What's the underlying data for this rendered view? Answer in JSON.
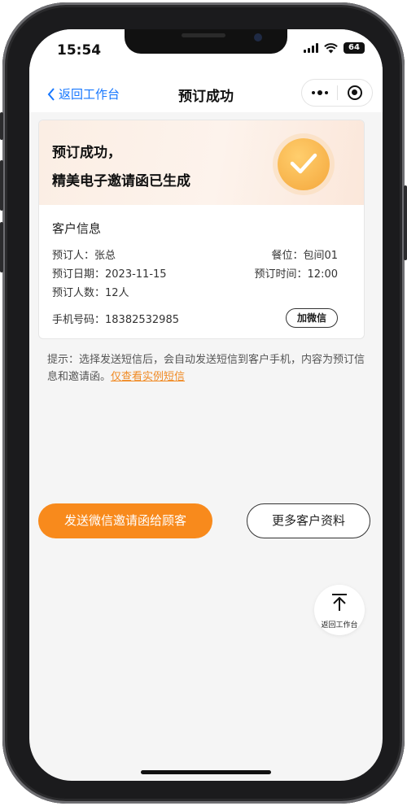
{
  "status_bar": {
    "time": "15:54",
    "battery": "64"
  },
  "nav": {
    "back_label": "返回工作台",
    "title": "预订成功"
  },
  "success": {
    "line1": "预订成功，",
    "line2": "精美电子邀请函已生成"
  },
  "customer": {
    "title": "客户信息",
    "booker_label": "预订人：",
    "booker": "张总",
    "seat_label": "餐位：",
    "seat": "包间01",
    "date_label": "预订日期：",
    "date": "2023-11-15",
    "time_label": "预订时间：",
    "time": "12:00",
    "people_label": "预订人数：",
    "people": "12人",
    "phone_label": "手机号码：",
    "phone": "18382532985",
    "wechat_button": "加微信"
  },
  "tip": {
    "text": "提示：选择发送短信后，会自动发送短信到客户手机，内容为预订信息和邀请函。",
    "link": "仅查看实例短信"
  },
  "actions": {
    "send_invite": "发送微信邀请函给顾客",
    "more_info": "更多客户资料"
  },
  "fab": {
    "label": "返回工作台"
  },
  "colors": {
    "accent": "#f88a1c",
    "link_blue": "#1677ff",
    "tip_link": "#f08a24",
    "background": "#f5f5f5"
  }
}
